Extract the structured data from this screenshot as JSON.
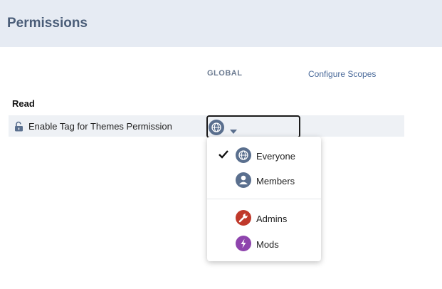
{
  "header": {
    "title": "Permissions"
  },
  "columns": {
    "global_label": "GLOBAL",
    "configure_scopes": "Configure Scopes"
  },
  "section": {
    "title": "Read"
  },
  "permission": {
    "label": "Enable Tag for Themes Permission",
    "selected_scope": "Everyone",
    "selected_icon": "globe-icon"
  },
  "dropdown": {
    "items": [
      {
        "label": "Everyone",
        "icon": "globe-icon",
        "color": "#5a6f8e",
        "checked": true
      },
      {
        "label": "Members",
        "icon": "person-icon",
        "color": "#5a6f8e",
        "checked": false
      },
      {
        "label": "Admins",
        "icon": "wrench-icon",
        "color": "#c0392b",
        "checked": false
      },
      {
        "label": "Mods",
        "icon": "lightning-icon",
        "color": "#8e44ad",
        "checked": false
      }
    ]
  },
  "colors": {
    "header_bg": "#e6ebf3",
    "row_bg": "#eef1f5",
    "globe": "#5a6f8e",
    "admins": "#c0392b",
    "mods": "#8e44ad"
  }
}
